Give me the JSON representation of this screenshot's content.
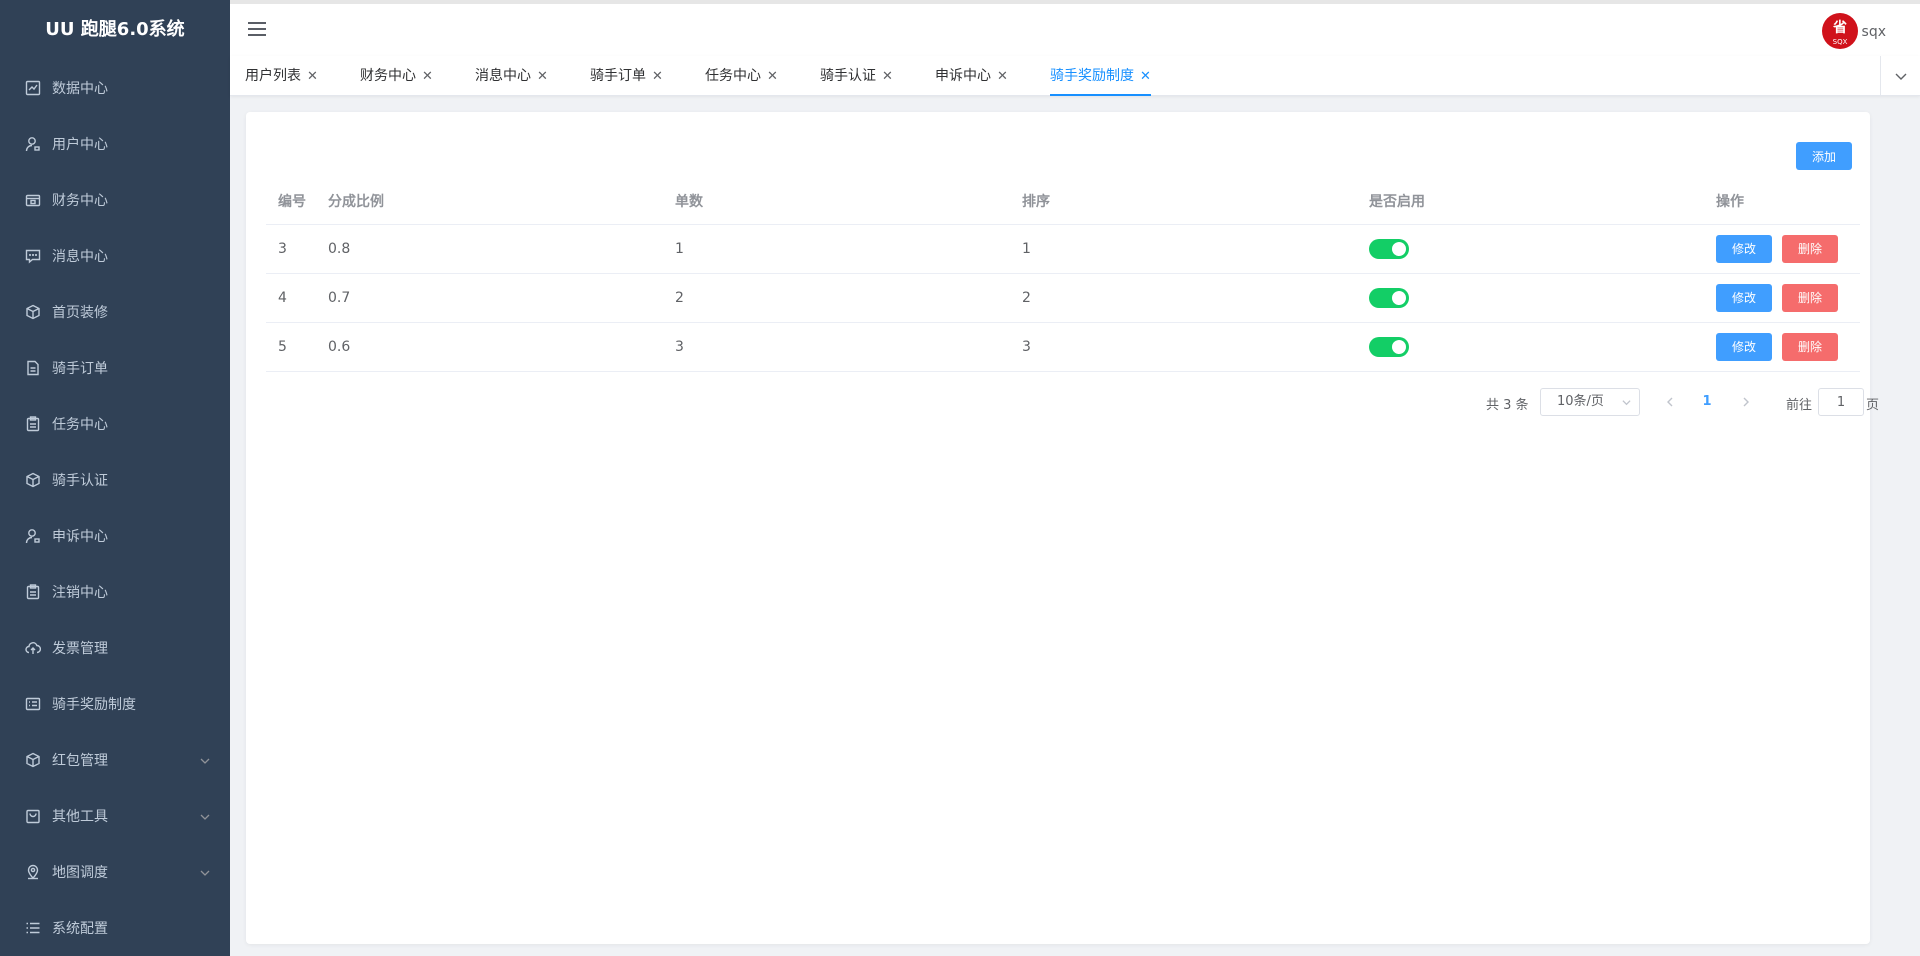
{
  "app": {
    "title": "UU 跑腿6.0系统"
  },
  "sidebar": {
    "items": [
      {
        "label": "数据中心",
        "icon": "chart-icon"
      },
      {
        "label": "用户中心",
        "icon": "user-icon"
      },
      {
        "label": "财务中心",
        "icon": "wallet-icon"
      },
      {
        "label": "消息中心",
        "icon": "message-icon"
      },
      {
        "label": "首页装修",
        "icon": "box-icon"
      },
      {
        "label": "骑手订单",
        "icon": "document-icon"
      },
      {
        "label": "任务中心",
        "icon": "clipboard-icon"
      },
      {
        "label": "骑手认证",
        "icon": "box-icon"
      },
      {
        "label": "申诉中心",
        "icon": "user-icon"
      },
      {
        "label": "注销中心",
        "icon": "clipboard-icon"
      },
      {
        "label": "发票管理",
        "icon": "cloud-upload-icon"
      },
      {
        "label": "骑手奖励制度",
        "icon": "list-icon"
      },
      {
        "label": "红包管理",
        "icon": "box-icon",
        "expandable": true
      },
      {
        "label": "其他工具",
        "icon": "bag-icon",
        "expandable": true
      },
      {
        "label": "地图调度",
        "icon": "location-icon",
        "expandable": true
      },
      {
        "label": "系统配置",
        "icon": "menu-list-icon"
      }
    ]
  },
  "header": {
    "username": "sqx",
    "avatar_text": "省",
    "avatar_sub": "SQX"
  },
  "tags": [
    {
      "label": "用户列表"
    },
    {
      "label": "财务中心"
    },
    {
      "label": "消息中心"
    },
    {
      "label": "骑手订单"
    },
    {
      "label": "任务中心"
    },
    {
      "label": "骑手认证"
    },
    {
      "label": "申诉中心"
    },
    {
      "label": "骑手奖励制度",
      "active": true
    }
  ],
  "toolbar": {
    "add_label": "添加"
  },
  "table": {
    "columns": [
      "编号",
      "分成比例",
      "单数",
      "排序",
      "是否启用",
      "操作"
    ],
    "rows": [
      {
        "id": "3",
        "ratio": "0.8",
        "count": "1",
        "sort": "1",
        "enabled": true
      },
      {
        "id": "4",
        "ratio": "0.7",
        "count": "2",
        "sort": "2",
        "enabled": true
      },
      {
        "id": "5",
        "ratio": "0.6",
        "count": "3",
        "sort": "3",
        "enabled": true
      }
    ],
    "edit_label": "修改",
    "delete_label": "删除"
  },
  "pagination": {
    "total_text": "共 3 条",
    "page_size": "10条/页",
    "current_page": "1",
    "goto_prefix": "前往",
    "goto_value": "1",
    "goto_suffix": "页"
  },
  "colors": {
    "sidebar_bg": "#304156",
    "primary": "#409eff",
    "danger": "#f56c6c",
    "switch_on": "#13ce66",
    "tag_active": "#1890ff",
    "avatar_bg": "#d0121b"
  }
}
